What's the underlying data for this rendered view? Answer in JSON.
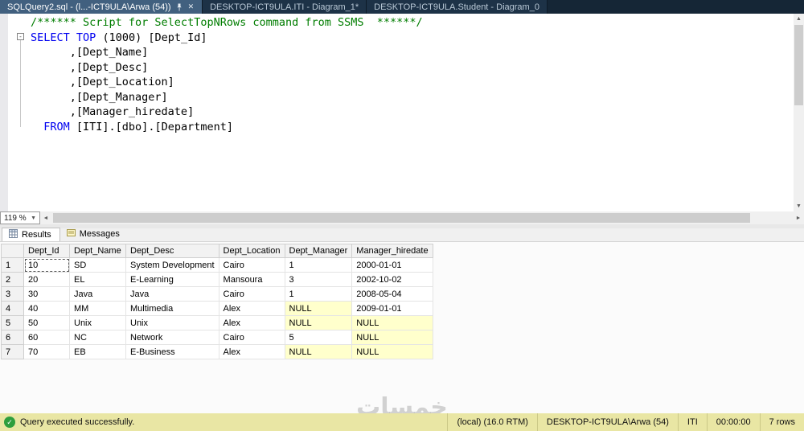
{
  "tabs": [
    {
      "label": "SQLQuery2.sql - (l...-ICT9ULA\\Arwa (54))",
      "active": true
    },
    {
      "label": "DESKTOP-ICT9ULA.ITI - Diagram_1*",
      "active": false
    },
    {
      "label": "DESKTOP-ICT9ULA.Student - Diagram_0",
      "active": false
    }
  ],
  "editor": {
    "zoom_level": "119 %",
    "fold_glyph": "-",
    "code_lines": [
      {
        "tokens": [
          {
            "text": "/****** Script for SelectTopNRows command from SSMS  ******/",
            "type": "comment"
          }
        ]
      },
      {
        "tokens": [
          {
            "text": "SELECT",
            "type": "keyword"
          },
          {
            "text": " ",
            "type": "plain"
          },
          {
            "text": "TOP",
            "type": "keyword"
          },
          {
            "text": " (1000) [Dept_Id]",
            "type": "plain"
          }
        ]
      },
      {
        "tokens": [
          {
            "text": "      ,[Dept_Name]",
            "type": "plain"
          }
        ]
      },
      {
        "tokens": [
          {
            "text": "      ,[Dept_Desc]",
            "type": "plain"
          }
        ]
      },
      {
        "tokens": [
          {
            "text": "      ,[Dept_Location]",
            "type": "plain"
          }
        ]
      },
      {
        "tokens": [
          {
            "text": "      ,[Dept_Manager]",
            "type": "plain"
          }
        ]
      },
      {
        "tokens": [
          {
            "text": "      ,[Manager_hiredate]",
            "type": "plain"
          }
        ]
      },
      {
        "tokens": [
          {
            "text": "  ",
            "type": "plain"
          },
          {
            "text": "FROM",
            "type": "keyword"
          },
          {
            "text": " [ITI].[dbo].[Department]",
            "type": "plain"
          }
        ]
      }
    ]
  },
  "results_pane": {
    "results_tab_label": "Results",
    "messages_tab_label": "Messages",
    "grid": {
      "columns": [
        "Dept_Id",
        "Dept_Name",
        "Dept_Desc",
        "Dept_Location",
        "Dept_Manager",
        "Manager_hiredate"
      ],
      "rows": [
        [
          "10",
          "SD",
          "System Development",
          "Cairo",
          "1",
          "2000-01-01"
        ],
        [
          "20",
          "EL",
          "E-Learning",
          "Mansoura",
          "3",
          "2002-10-02"
        ],
        [
          "30",
          "Java",
          "Java",
          "Cairo",
          "1",
          "2008-05-04"
        ],
        [
          "40",
          "MM",
          "Multimedia",
          "Alex",
          "NULL",
          "2009-01-01"
        ],
        [
          "50",
          "Unix",
          "Unix",
          "Alex",
          "NULL",
          "NULL"
        ],
        [
          "60",
          "NC",
          "Network",
          "Cairo",
          "5",
          "NULL"
        ],
        [
          "70",
          "EB",
          "E-Business",
          "Alex",
          "NULL",
          "NULL"
        ]
      ],
      "selected_cell": {
        "row": 0,
        "col": 0
      },
      "null_color": "#ffffcc"
    }
  },
  "status_bar": {
    "check_glyph": "✓",
    "message": "Query executed successfully.",
    "server": "(local) (16.0 RTM)",
    "user": "DESKTOP-ICT9ULA\\Arwa (54)",
    "database": "ITI",
    "elapsed_time": "00:00:00",
    "row_count": "7 rows"
  },
  "watermark_text": "خمسات",
  "colors": {
    "keyword": "#0000f0",
    "comment": "#007d00",
    "status_bg": "#e9e6a4",
    "tab_active_bg": "#41607f"
  }
}
